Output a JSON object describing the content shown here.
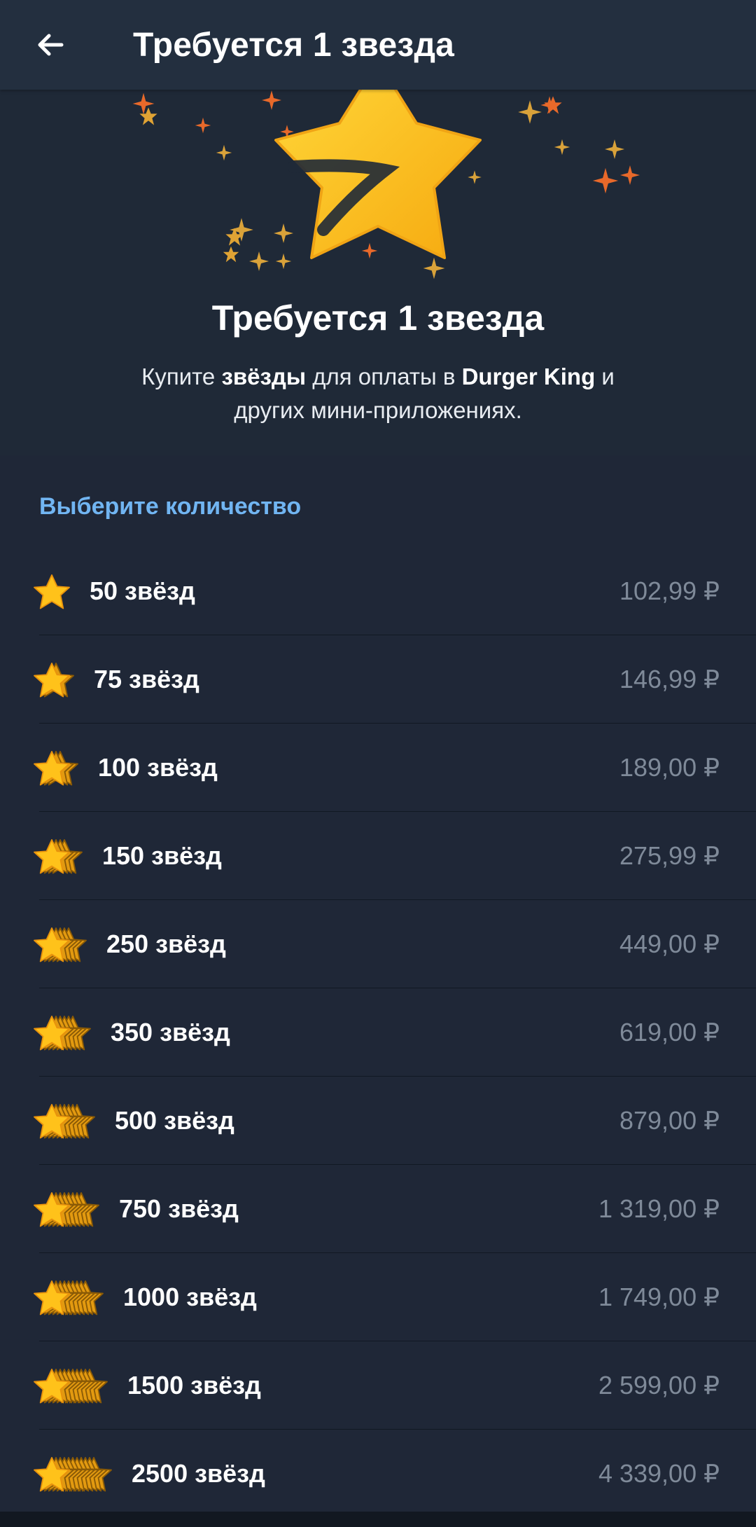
{
  "header": {
    "title": "Требуется 1 звезда",
    "back_icon": "arrow-left-icon"
  },
  "hero": {
    "title": "Требуется 1 звезда",
    "description_parts": {
      "p1": "Купите ",
      "p2": "звёзды",
      "p3": " для оплаты в ",
      "p4": "Durger King",
      "p5": " и других мини-приложениях."
    },
    "star_icon": "telegram-star-icon",
    "colors": {
      "star_yellow": "#ffc21a",
      "sparkle_orange": "#e8692a"
    }
  },
  "list": {
    "section_label": "Выберите количество",
    "options": [
      {
        "label": "50 звёзд",
        "price": "102,99 ₽",
        "stack_count": 1
      },
      {
        "label": "75 звёзд",
        "price": "146,99 ₽",
        "stack_count": 2
      },
      {
        "label": "100 звёзд",
        "price": "189,00 ₽",
        "stack_count": 3
      },
      {
        "label": "150 звёзд",
        "price": "275,99 ₽",
        "stack_count": 4
      },
      {
        "label": "250 звёзд",
        "price": "449,00 ₽",
        "stack_count": 5
      },
      {
        "label": "350 звёзд",
        "price": "619,00 ₽",
        "stack_count": 6
      },
      {
        "label": "500 звёзд",
        "price": "879,00 ₽",
        "stack_count": 7
      },
      {
        "label": "750 звёзд",
        "price": "1 319,00 ₽",
        "stack_count": 8
      },
      {
        "label": "1000 звёзд",
        "price": "1 749,00 ₽",
        "stack_count": 9
      },
      {
        "label": "1500 звёзд",
        "price": "2 599,00 ₽",
        "stack_count": 10
      },
      {
        "label": "2500 звёзд",
        "price": "4 339,00 ₽",
        "stack_count": 11
      }
    ]
  },
  "colors": {
    "accent_blue": "#71b5f2",
    "price_gray": "#7f8a99",
    "background": "#1f2737"
  }
}
